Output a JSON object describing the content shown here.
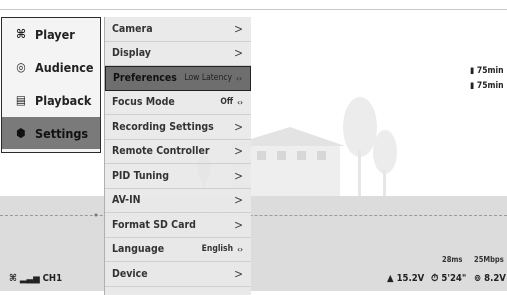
{
  "nav": {
    "items": [
      {
        "icon": "⌘",
        "label": "Player",
        "active": false
      },
      {
        "icon": "◎",
        "label": "Audience",
        "active": false
      },
      {
        "icon": "▤",
        "label": "Playback",
        "active": false
      },
      {
        "icon": "⬢",
        "label": "Settings",
        "active": true
      }
    ]
  },
  "submenu": {
    "rows": [
      {
        "label": "Camera",
        "value": "",
        "control": "arrow"
      },
      {
        "label": "Display",
        "value": "",
        "control": "arrow"
      },
      {
        "label": "Preferences",
        "value": "Low Latency",
        "control": "dots",
        "selected": true
      },
      {
        "label": "Focus Mode",
        "value": "Off",
        "control": "dots"
      },
      {
        "label": "Recording Settings",
        "value": "",
        "control": "arrow"
      },
      {
        "label": "Remote Controller",
        "value": "",
        "control": "arrow"
      },
      {
        "label": "PID Tuning",
        "value": "",
        "control": "arrow"
      },
      {
        "label": "AV-IN",
        "value": "",
        "control": "arrow"
      },
      {
        "label": "Format SD Card",
        "value": "",
        "control": "arrow"
      },
      {
        "label": "Language",
        "value": "English",
        "control": "dots"
      },
      {
        "label": "Device",
        "value": "",
        "control": "arrow"
      }
    ]
  },
  "overlay": {
    "battery1": "75min",
    "battery2": "75min",
    "latency": "28ms",
    "bitrate": "25Mbps",
    "voltage": "15.2V",
    "flight_time": "5'24\"",
    "goggles_voltage": "8.2V",
    "channel": "CH1"
  },
  "colors": {
    "active_nav": "#7a7a7a",
    "selected_row": "#6e6e6e"
  }
}
